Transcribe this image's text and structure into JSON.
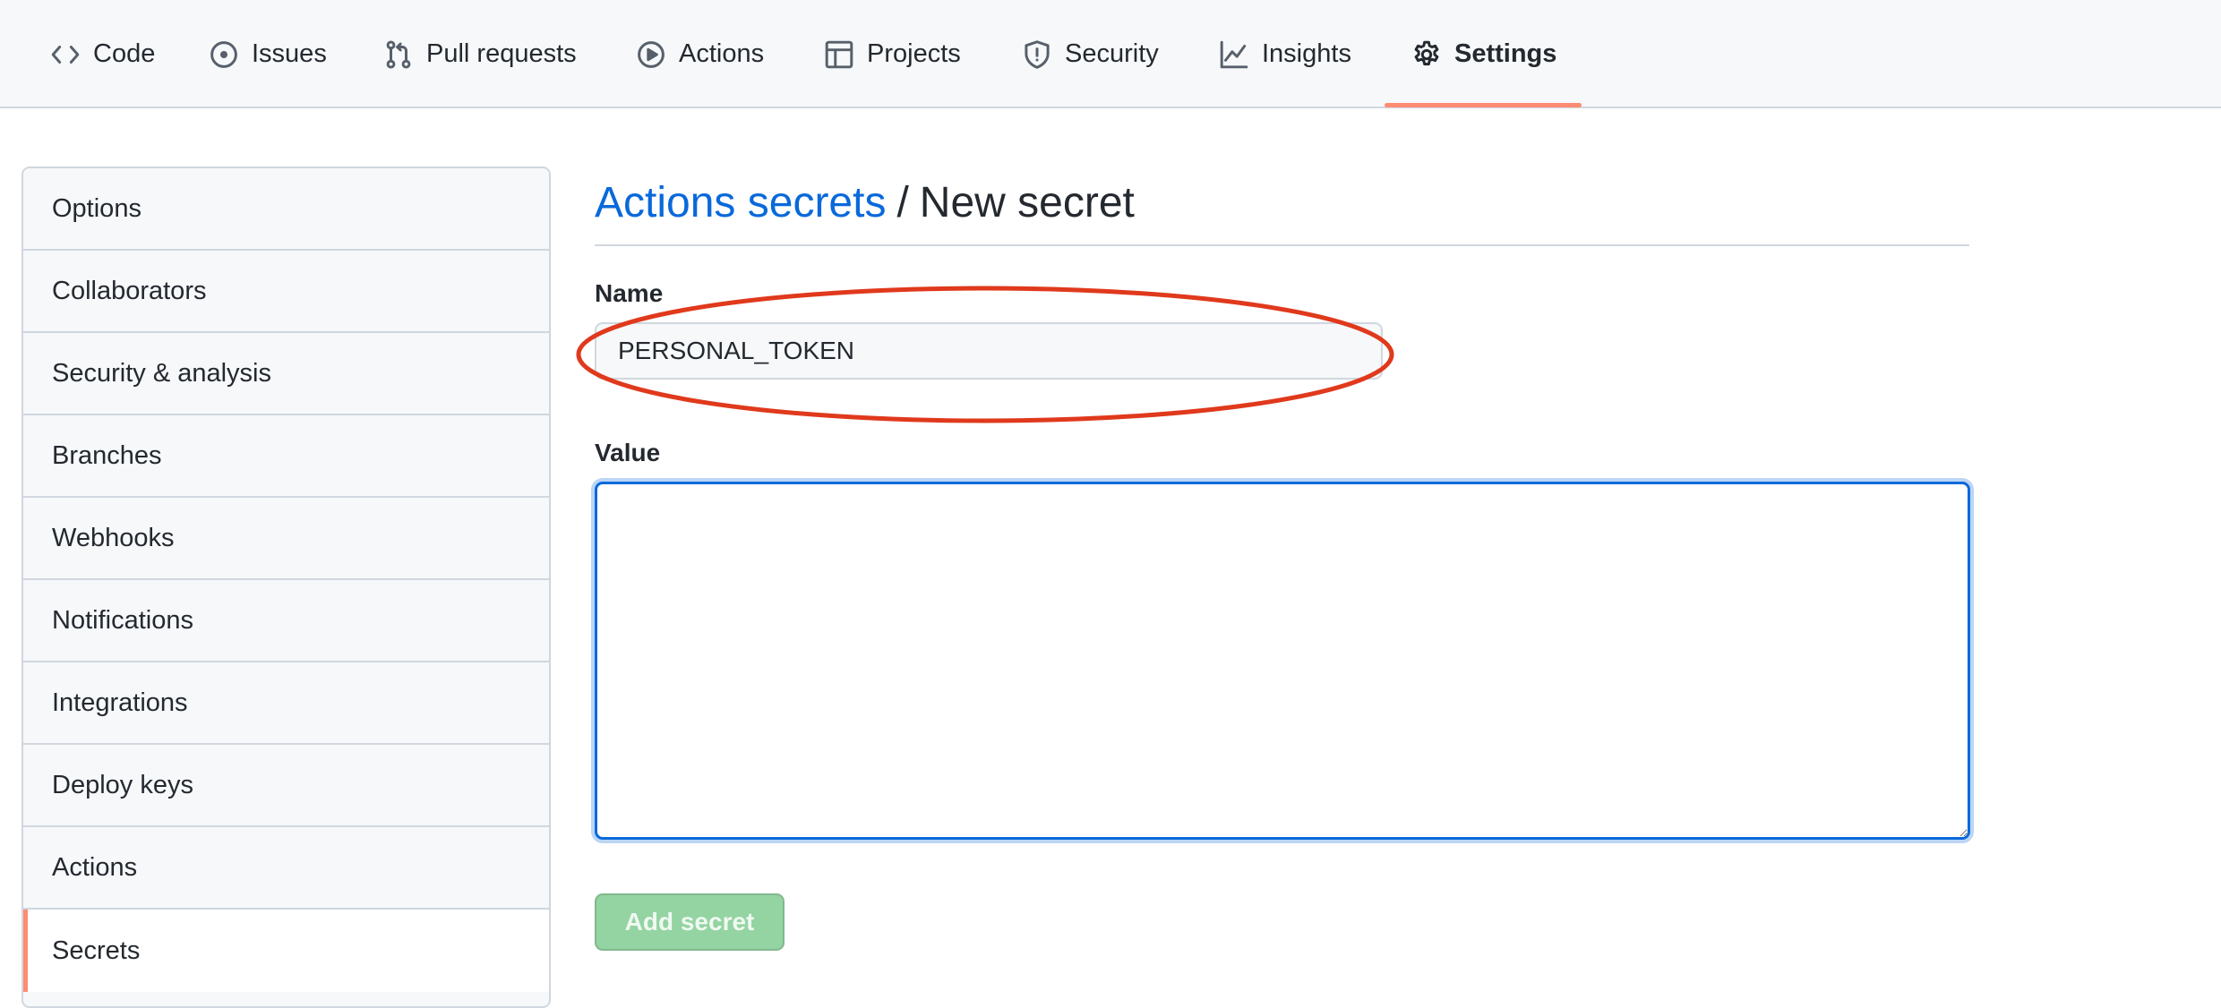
{
  "nav": {
    "tabs": [
      {
        "label": "Code",
        "icon": "code-icon"
      },
      {
        "label": "Issues",
        "icon": "issue-opened-icon"
      },
      {
        "label": "Pull requests",
        "icon": "git-pull-request-icon"
      },
      {
        "label": "Actions",
        "icon": "play-icon"
      },
      {
        "label": "Projects",
        "icon": "table-icon"
      },
      {
        "label": "Security",
        "icon": "shield-icon"
      },
      {
        "label": "Insights",
        "icon": "graph-icon"
      },
      {
        "label": "Settings",
        "icon": "gear-icon",
        "active": true
      }
    ],
    "active_underline_color": "#fd8c73"
  },
  "sidebar": {
    "items": [
      {
        "label": "Options"
      },
      {
        "label": "Collaborators"
      },
      {
        "label": "Security & analysis"
      },
      {
        "label": "Branches"
      },
      {
        "label": "Webhooks"
      },
      {
        "label": "Notifications"
      },
      {
        "label": "Integrations"
      },
      {
        "label": "Deploy keys"
      },
      {
        "label": "Actions"
      },
      {
        "label": "Secrets",
        "selected": true
      }
    ]
  },
  "main": {
    "breadcrumb": {
      "link": "Actions secrets",
      "separator": "/",
      "current": "New secret"
    },
    "name_field": {
      "label": "Name",
      "value": "PERSONAL_TOKEN"
    },
    "value_field": {
      "label": "Value",
      "value": ""
    },
    "submit_label": "Add secret",
    "annotation_color": "#e0391c"
  },
  "colors": {
    "link": "#0969da",
    "button_disabled": "#94d3a2",
    "focus_border": "#0969da"
  }
}
